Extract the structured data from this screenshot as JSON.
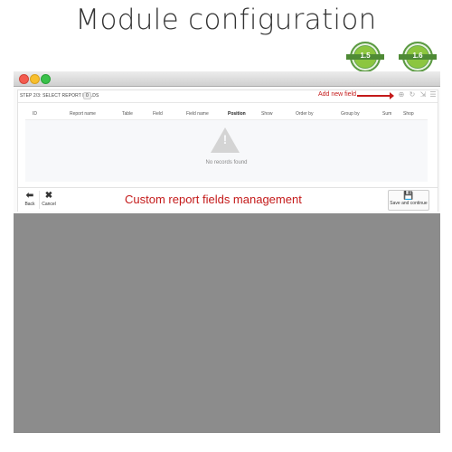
{
  "headline": "Module configuration",
  "badges": [
    {
      "version": "1.5",
      "ring_text": "PRESTASHOP",
      "color": "#6aa84f"
    },
    {
      "version": "1.6",
      "ring_text": "PRESTASHOP",
      "color": "#6aa84f"
    }
  ],
  "panel": {
    "step_title": "STEP 2/3: SELECT REPORT FIELDS",
    "record_count": "0",
    "add_new_label": "Add new field",
    "toolbar_icons": [
      "add-icon",
      "refresh-icon",
      "export-icon",
      "sql-icon"
    ]
  },
  "table": {
    "headers": [
      "ID",
      "Report name",
      "Table",
      "Field",
      "Field name",
      "Position",
      "Show",
      "Order by",
      "Group by",
      "Sum",
      "Shop"
    ],
    "empty_message": "No records found"
  },
  "footer": {
    "back_label": "Back",
    "cancel_label": "Cancel",
    "annotation": "Custom report fields management",
    "save_label": "Save and continue"
  },
  "colors": {
    "accent_red": "#c41a1a",
    "badge_green": "#6aa84f",
    "window_gray": "#8c8c8c"
  }
}
